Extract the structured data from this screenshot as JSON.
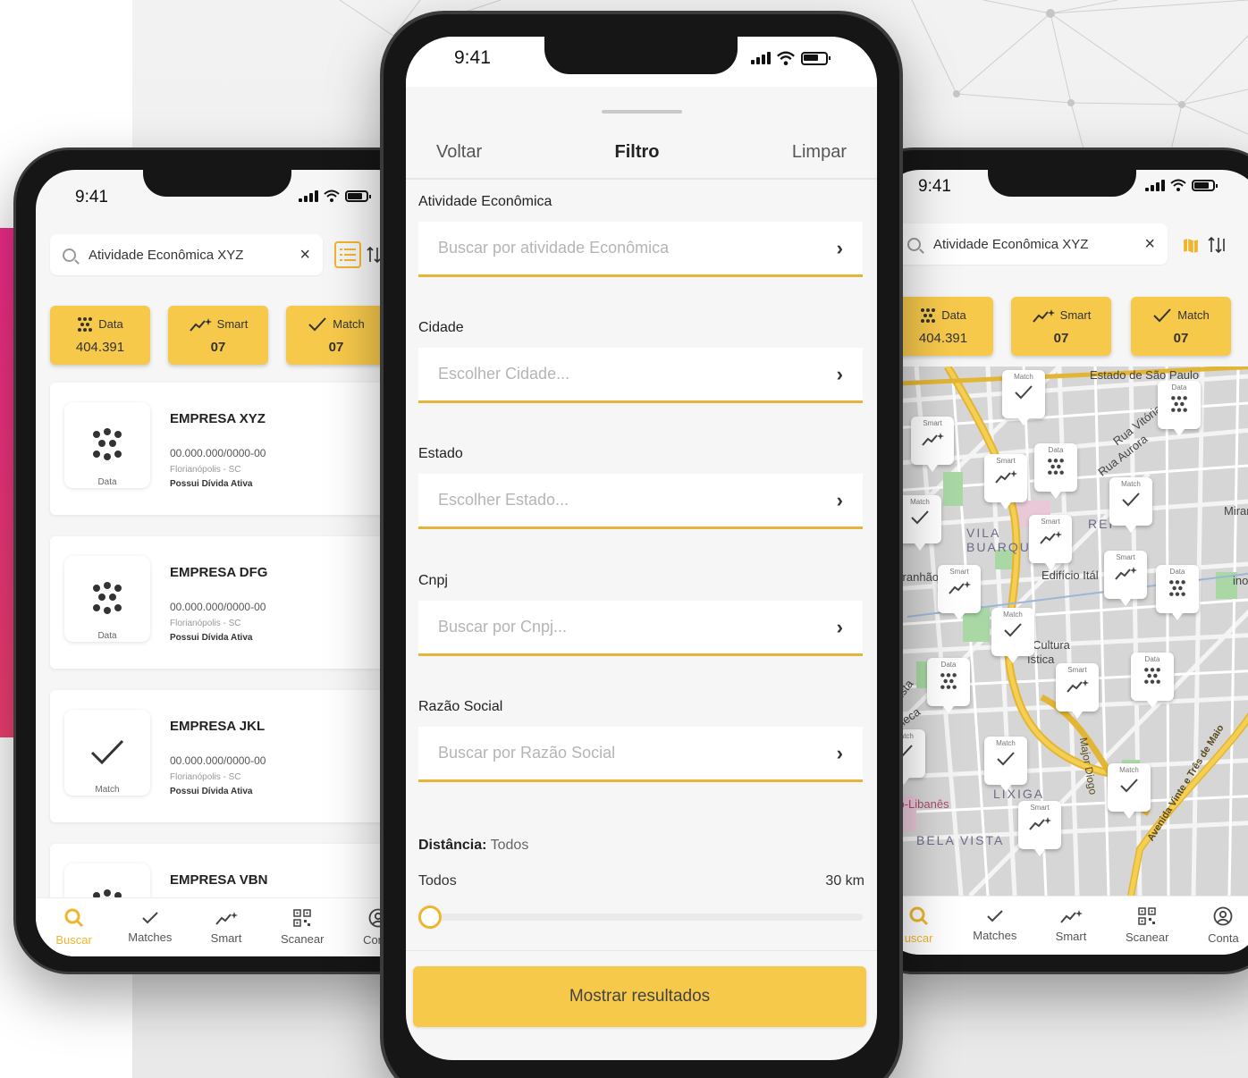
{
  "left_phone": {
    "status_time": "9:41",
    "search": {
      "value": "Atividade Econômica XYZ"
    },
    "categories": [
      {
        "label": "Data",
        "value": "404.391",
        "icon": "dots-icon"
      },
      {
        "label": "Smart",
        "value": "07",
        "icon": "sparkle-chart-icon"
      },
      {
        "label": "Match",
        "value": "07",
        "icon": "check-icon"
      }
    ],
    "companies": [
      {
        "name": "EMPRESA XYZ",
        "cnpj": "00.000.000/0000-00",
        "city": "Florianópolis - SC",
        "debt": "Possui Dívida Ativa",
        "tag": "Data"
      },
      {
        "name": "EMPRESA DFG",
        "cnpj": "00.000.000/0000-00",
        "city": "Florianópolis - SC",
        "debt": "Possui Dívida Ativa",
        "tag": "Data"
      },
      {
        "name": "EMPRESA JKL",
        "cnpj": "00.000.000/0000-00",
        "city": "Florianópolis - SC",
        "debt": "Possui Dívida Ativa",
        "tag": "Match"
      },
      {
        "name": "EMPRESA VBN"
      }
    ],
    "nav": [
      "Buscar",
      "Matches",
      "Smart",
      "Scanear",
      "Conta"
    ]
  },
  "middle_phone": {
    "status_time": "9:41",
    "header": {
      "back": "Voltar",
      "title": "Filtro",
      "clear": "Limpar"
    },
    "fields": [
      {
        "label": "Atividade Econômica",
        "placeholder": "Buscar por atividade Econômica"
      },
      {
        "label": "Cidade",
        "placeholder": "Escolher Cidade..."
      },
      {
        "label": "Estado",
        "placeholder": "Escolher Estado..."
      },
      {
        "label": "Cnpj",
        "placeholder": "Buscar por Cnpj..."
      },
      {
        "label": "Razão Social",
        "placeholder": "Buscar por Razão Social"
      }
    ],
    "distance": {
      "label": "Distância:",
      "value": "Todos",
      "min_label": "Todos",
      "max_label": "30 km",
      "position": 0
    },
    "cta": "Mostrar resultados"
  },
  "right_phone": {
    "status_time": "9:41",
    "search": {
      "value": "Atividade Econômica XYZ"
    },
    "categories": [
      {
        "label": "Data",
        "value": "404.391"
      },
      {
        "label": "Smart",
        "value": "07"
      },
      {
        "label": "Match",
        "value": "07"
      }
    ],
    "map_labels": {
      "estado": "Estado de São Paulo",
      "rua_vitoria": "Rua Vitória",
      "rua_aurora": "Rua Aurora",
      "mirante": "Mirante",
      "vila_buarque": "VILA BUARQUE",
      "rep": "REP",
      "maranhao": "l Maranhão",
      "edificio": "Edifício Itál",
      "cultura": "Cultura",
      "stica": "ística",
      "augusta": "ugusta",
      "caneca": "Caneca",
      "major": "Major Diogo",
      "avenida": "Avenida Vinte e Três de Maio",
      "sirio": "Sírio-Libanês",
      "bela_vista": "BELA VISTA",
      "lixiga": "LIXIGA",
      "ino": "ino A"
    },
    "pin_labels": {
      "match": "Match",
      "smart": "Smart",
      "data": "Data"
    },
    "nav": [
      "uscar",
      "Matches",
      "Smart",
      "Scanear",
      "Conta"
    ]
  }
}
